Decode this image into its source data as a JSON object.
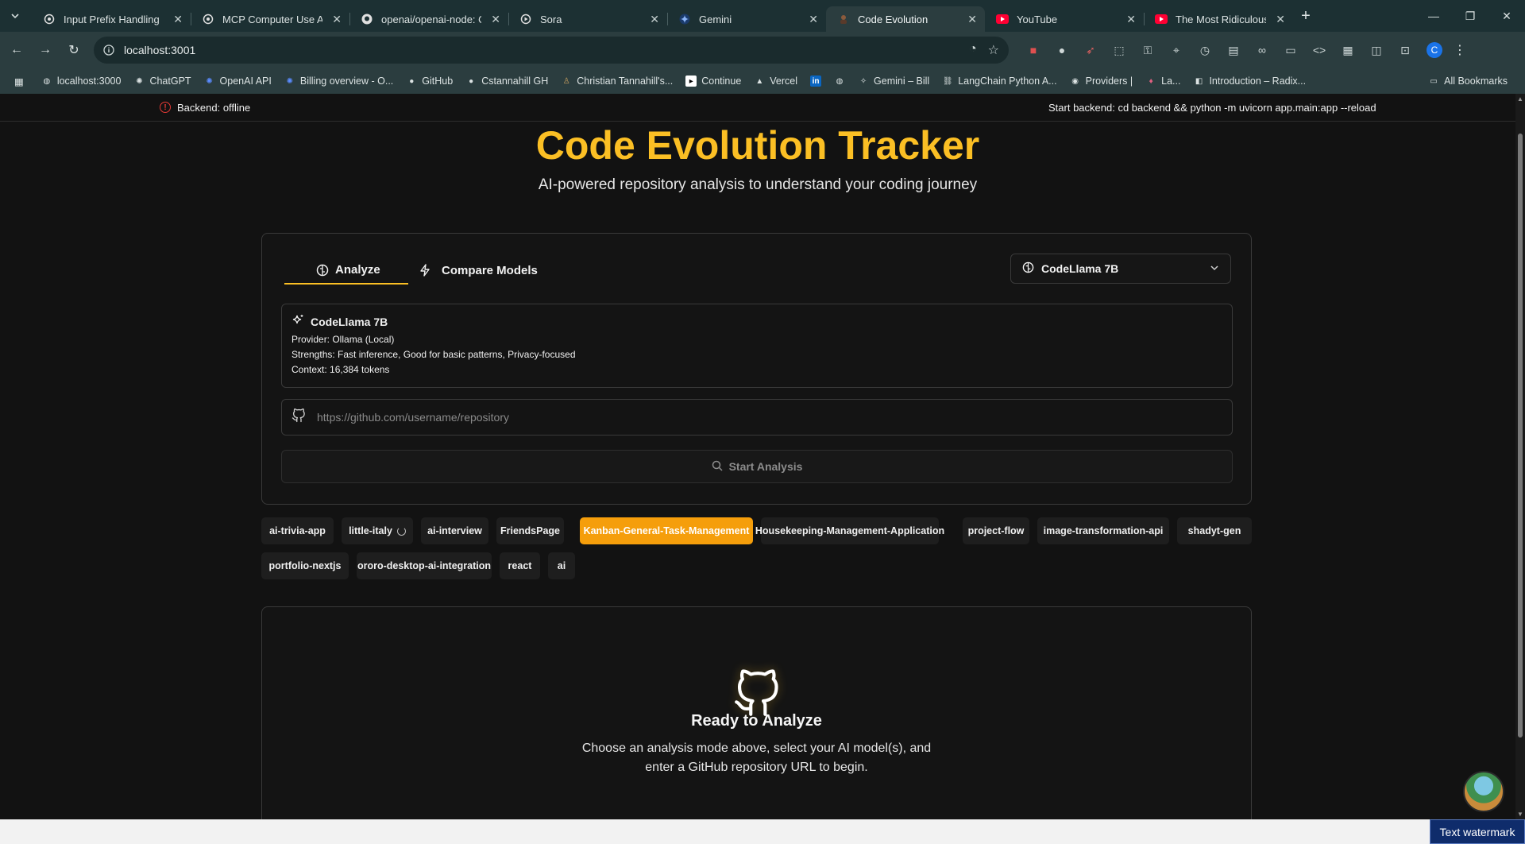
{
  "browser": {
    "tabs": [
      {
        "title": "Input Prefix Handling",
        "icon": "openai-icon",
        "active": false
      },
      {
        "title": "MCP Computer Use Agen",
        "icon": "openai-icon",
        "active": false
      },
      {
        "title": "openai/openai-node: Offic",
        "icon": "github-icon",
        "active": false
      },
      {
        "title": "Sora",
        "icon": "sora-icon",
        "active": false
      },
      {
        "title": "Gemini",
        "icon": "gemini-icon",
        "active": false
      },
      {
        "title": "Code Evolution",
        "icon": "app-icon",
        "active": true
      },
      {
        "title": "YouTube",
        "icon": "youtube-icon",
        "active": false
      },
      {
        "title": "The Most Ridiculous Miss",
        "icon": "youtube-icon",
        "active": false
      }
    ],
    "url": "localhost:3001",
    "profile_initial": "C",
    "bookmarks": [
      {
        "label": "localhost:3000",
        "icon": "globe-icon"
      },
      {
        "label": "ChatGPT",
        "icon": "openai-icon"
      },
      {
        "label": "OpenAI API",
        "icon": "openai-icon"
      },
      {
        "label": "Billing overview - O...",
        "icon": "openai-icon"
      },
      {
        "label": "GitHub",
        "icon": "github-icon"
      },
      {
        "label": "Cstannahill GH",
        "icon": "github-icon"
      },
      {
        "label": "Christian Tannahill's...",
        "icon": "person-icon"
      },
      {
        "label": "Continue",
        "icon": "continue-icon"
      },
      {
        "label": "Vercel",
        "icon": "vercel-icon"
      },
      {
        "label": "",
        "icon": "linkedin-icon"
      },
      {
        "label": "",
        "icon": "globe-icon"
      },
      {
        "label": "Gemini – Bill",
        "icon": "gemini-icon"
      },
      {
        "label": "LangChain Python A...",
        "icon": "langchain-icon"
      },
      {
        "label": "Providers |",
        "icon": "providers-icon"
      },
      {
        "label": "La...",
        "icon": "link-icon"
      },
      {
        "label": "Introduction – Radix...",
        "icon": "radix-icon"
      }
    ],
    "all_bookmarks": "All Bookmarks"
  },
  "status": {
    "backend": "Backend: offline",
    "hint": "Start backend: cd backend && python -m uvicorn app.main:app --reload",
    "color": "#e53935"
  },
  "hero": {
    "title": "Code Evolution Tracker",
    "subtitle": "AI-powered repository analysis to understand your coding journey",
    "accent": "#fbbf24"
  },
  "analysis": {
    "tabs": {
      "analyze": "Analyze",
      "compare": "Compare Models"
    },
    "selected_model": "CodeLlama 7B",
    "model_info": {
      "name": "CodeLlama 7B",
      "provider": "Provider: Ollama (Local)",
      "strengths": "Strengths: Fast inference, Good for basic patterns, Privacy-focused",
      "context": "Context: 16,384 tokens"
    },
    "repo_placeholder": "https://github.com/username/repository",
    "start_label": "Start Analysis"
  },
  "repos": [
    {
      "label": "ai-trivia-app",
      "active": false
    },
    {
      "label": "little-italy",
      "active": false,
      "loading": true
    },
    {
      "label": "ai-interview",
      "active": false
    },
    {
      "label": "FriendsPage",
      "active": false
    },
    {
      "label": "Kanban-General-Task-Management",
      "active": true
    },
    {
      "label": "Housekeeping-Management-Application",
      "active": false
    },
    {
      "label": "project-flow",
      "active": false
    },
    {
      "label": "image-transformation-api",
      "active": false
    },
    {
      "label": "shadyt-gen",
      "active": false
    },
    {
      "label": "portfolio-nextjs",
      "active": false
    },
    {
      "label": "ororo-desktop-ai-integration",
      "active": false
    },
    {
      "label": "react",
      "active": false
    },
    {
      "label": "ai",
      "active": false
    }
  ],
  "empty_state": {
    "title": "Ready to Analyze",
    "line1": "Choose an analysis mode above, select your AI model(s), and",
    "line2": "enter a GitHub repository URL to begin."
  },
  "watermark": "Text watermark",
  "colors": {
    "active_chip": "#f59e0b",
    "chrome": "#2b3d3f"
  }
}
